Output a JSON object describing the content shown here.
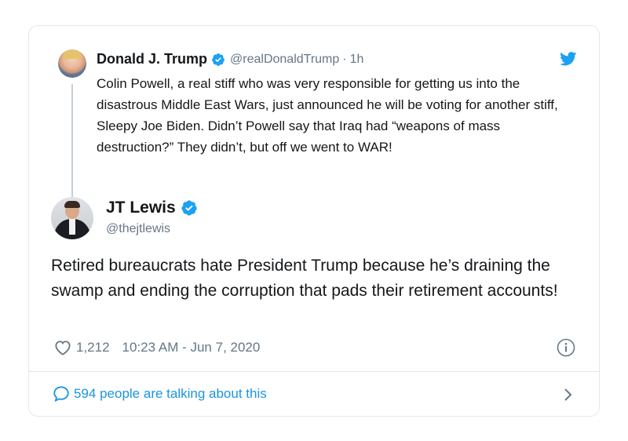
{
  "quoted_tweet": {
    "author_name": "Donald J. Trump",
    "handle": "@realDonaldTrump",
    "separator": "·",
    "time": "1h",
    "text": "Colin Powell, a real stiff who was very responsible for getting us into the disastrous Middle East Wars, just announced he will be voting for another stiff, Sleepy Joe Biden. Didn’t Powell say that Iraq had “weapons of mass destruction?” They didn’t, but off we went to WAR!"
  },
  "tweet": {
    "author_name": "JT Lewis",
    "handle": "@thejtlewis",
    "text": "Retired bureaucrats hate President Trump because he’s draining the swamp and ending the corruption that pads their retirement accounts!",
    "likes": "1,212",
    "timestamp": "10:23 AM - Jun 7, 2020"
  },
  "footer": {
    "talking_label": "594 people are talking about this"
  },
  "colors": {
    "accent": "#1da1f2",
    "link": "#1b95e0",
    "muted": "#657786",
    "border": "#e1e8ed"
  },
  "icons": [
    "verified-badge-icon",
    "twitter-bird-icon",
    "heart-icon",
    "info-icon",
    "reply-bubble-icon",
    "chevron-right-icon"
  ]
}
